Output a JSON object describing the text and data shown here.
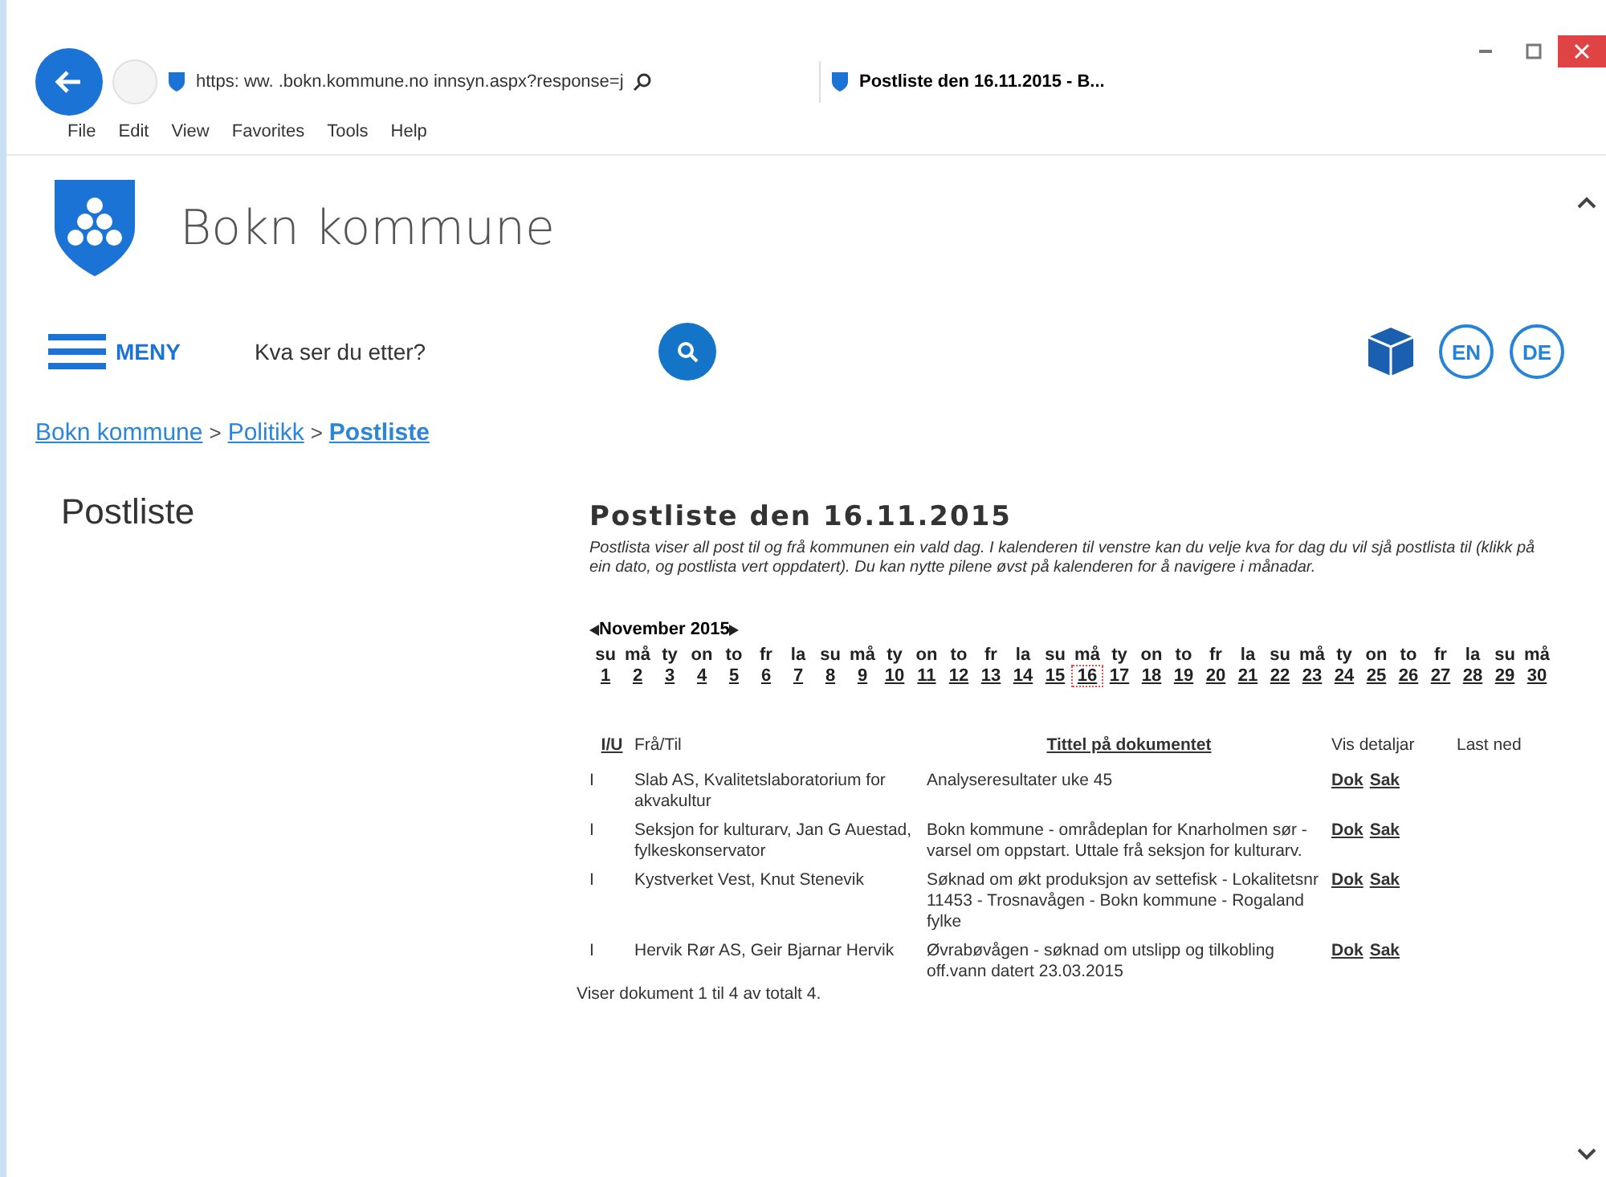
{
  "browser": {
    "address": "https:  ww. .bokn.kommune.no innsyn.aspx?response=j",
    "tab": "Postliste den 16.11.2015 - B...",
    "menu": [
      "File",
      "Edit",
      "View",
      "Favorites",
      "Tools",
      "Help"
    ]
  },
  "site": {
    "name": "Bokn kommune",
    "menu_label": "MENY",
    "search": {
      "placeholder": "Kva ser du etter?"
    },
    "languages": [
      "EN",
      "DE"
    ]
  },
  "breadcrumb": {
    "items": [
      "Bokn kommune",
      "Politikk",
      "Postliste"
    ],
    "separators": [
      ">",
      ">"
    ]
  },
  "sidebar_title": "Postliste",
  "main": {
    "title": "Postliste den 16.11.2015",
    "intro": "Postlista viser all post til og frå kommunen ein vald dag. I kalenderen til venstre kan du velje kva for dag du vil sjå postlista til (klikk på ein dato, og postlista vert oppdatert). Du kan nytte pilene øvst på kalenderen for å navigere i månadar.",
    "calendar": {
      "month": "November 2015",
      "days": [
        {
          "weekday": "su",
          "day": "1",
          "selected": false
        },
        {
          "weekday": "må",
          "day": "2",
          "selected": false
        },
        {
          "weekday": "ty",
          "day": "3",
          "selected": false
        },
        {
          "weekday": "on",
          "day": "4",
          "selected": false
        },
        {
          "weekday": "to",
          "day": "5",
          "selected": false
        },
        {
          "weekday": "fr",
          "day": "6",
          "selected": false
        },
        {
          "weekday": "la",
          "day": "7",
          "selected": false
        },
        {
          "weekday": "su",
          "day": "8",
          "selected": false
        },
        {
          "weekday": "må",
          "day": "9",
          "selected": false
        },
        {
          "weekday": "ty",
          "day": "10",
          "selected": false
        },
        {
          "weekday": "on",
          "day": "11",
          "selected": false
        },
        {
          "weekday": "to",
          "day": "12",
          "selected": false
        },
        {
          "weekday": "fr",
          "day": "13",
          "selected": false
        },
        {
          "weekday": "la",
          "day": "14",
          "selected": false
        },
        {
          "weekday": "su",
          "day": "15",
          "selected": false
        },
        {
          "weekday": "må",
          "day": "16",
          "selected": true
        },
        {
          "weekday": "ty",
          "day": "17",
          "selected": false
        },
        {
          "weekday": "on",
          "day": "18",
          "selected": false
        },
        {
          "weekday": "to",
          "day": "19",
          "selected": false
        },
        {
          "weekday": "fr",
          "day": "20",
          "selected": false
        },
        {
          "weekday": "la",
          "day": "21",
          "selected": false
        },
        {
          "weekday": "su",
          "day": "22",
          "selected": false
        },
        {
          "weekday": "må",
          "day": "23",
          "selected": false
        },
        {
          "weekday": "ty",
          "day": "24",
          "selected": false
        },
        {
          "weekday": "on",
          "day": "25",
          "selected": false
        },
        {
          "weekday": "to",
          "day": "26",
          "selected": false
        },
        {
          "weekday": "fr",
          "day": "27",
          "selected": false
        },
        {
          "weekday": "la",
          "day": "28",
          "selected": false
        },
        {
          "weekday": "su",
          "day": "29",
          "selected": false
        },
        {
          "weekday": "må",
          "day": "30",
          "selected": false
        }
      ]
    },
    "table": {
      "columns": [
        "I/U",
        "Frå/Til",
        "Tittel på dokumentet",
        "Vis detaljar",
        "Last ned"
      ],
      "rows": [
        {
          "direction": "I",
          "from": "Slab AS, Kvalitetslaboratorium for akvakultur",
          "title": "Analyseresultater uke 45",
          "links": [
            "Dok",
            "Sak"
          ]
        },
        {
          "direction": "I",
          "from": "Seksjon for kulturarv, Jan G Auestad, fylkeskonservator",
          "title": "Bokn kommune - områdeplan for Knarholmen sør -varsel om oppstart. Uttale frå seksjon for kulturarv.",
          "links": [
            "Dok",
            "Sak"
          ]
        },
        {
          "direction": "I",
          "from": "Kystverket Vest, Knut Stenevik",
          "title": "Søknad om økt produksjon av settefisk - Lokalitetsnr 11453 - Trosnavågen - Bokn kommune - Rogaland fylke",
          "links": [
            "Dok",
            "Sak"
          ]
        },
        {
          "direction": "I",
          "from": "Hervik Rør AS, Geir Bjarnar Hervik",
          "title": "Øvrabøvågen - søknad om utslipp og tilkobling off.vann datert 23.03.2015",
          "links": [
            "Dok",
            "Sak"
          ]
        }
      ]
    },
    "summary": "Viser dokument 1 til 4 av totalt 4."
  }
}
